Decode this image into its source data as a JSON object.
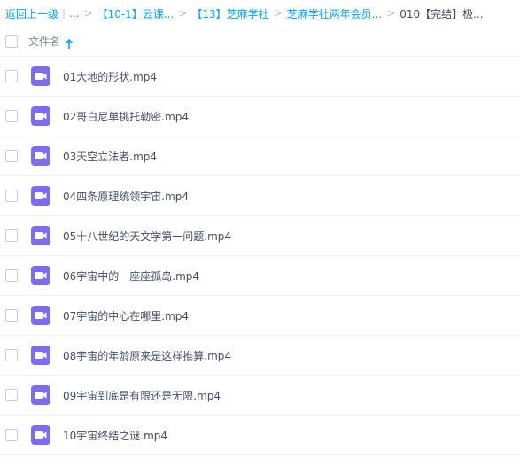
{
  "breadcrumb": {
    "back_label": "返回上一级",
    "ellipsis": "...",
    "items": [
      "【10-1】云课...",
      "【13】芝麻学社",
      "芝麻学社两年会员...",
      "010【完结】极..."
    ]
  },
  "header": {
    "column_label": "文件名",
    "sort_icon": "arrow-up-icon"
  },
  "files": [
    {
      "name": "01大地的形状.mp4",
      "icon": "video-file-icon"
    },
    {
      "name": "02哥白尼单挑托勒密.mp4",
      "icon": "video-file-icon"
    },
    {
      "name": "03天空立法者.mp4",
      "icon": "video-file-icon"
    },
    {
      "name": "04四条原理统领宇宙.mp4",
      "icon": "video-file-icon"
    },
    {
      "name": "05十八世纪的天文学第一问题.mp4",
      "icon": "video-file-icon"
    },
    {
      "name": "06宇宙中的一座座孤岛.mp4",
      "icon": "video-file-icon"
    },
    {
      "name": "07宇宙的中心在哪里.mp4",
      "icon": "video-file-icon"
    },
    {
      "name": "08宇宙的年龄原来是这样推算.mp4",
      "icon": "video-file-icon"
    },
    {
      "name": "09宇宙到底是有限还是无限.mp4",
      "icon": "video-file-icon"
    },
    {
      "name": "10宇宙终结之谜.mp4",
      "icon": "video-file-icon"
    }
  ],
  "colors": {
    "accent": "#06a7ff",
    "video_icon": "#7c6cf2"
  }
}
